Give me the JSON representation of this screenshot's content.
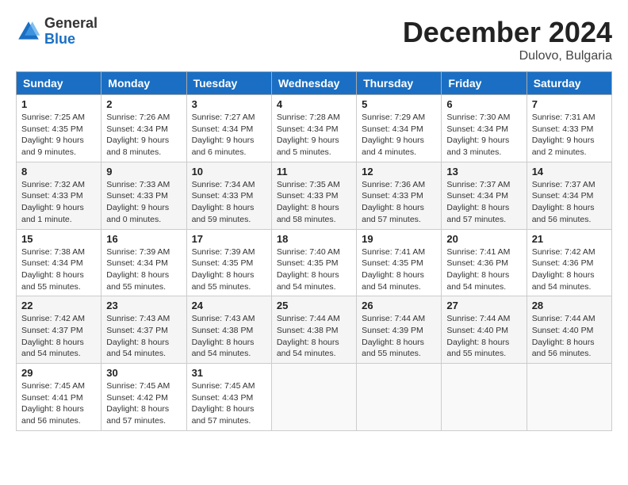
{
  "header": {
    "logo_general": "General",
    "logo_blue": "Blue",
    "month_title": "December 2024",
    "location": "Dulovo, Bulgaria"
  },
  "days_of_week": [
    "Sunday",
    "Monday",
    "Tuesday",
    "Wednesday",
    "Thursday",
    "Friday",
    "Saturday"
  ],
  "weeks": [
    [
      {
        "day": "1",
        "sunrise": "7:25 AM",
        "sunset": "4:35 PM",
        "daylight": "9 hours and 9 minutes."
      },
      {
        "day": "2",
        "sunrise": "7:26 AM",
        "sunset": "4:34 PM",
        "daylight": "9 hours and 8 minutes."
      },
      {
        "day": "3",
        "sunrise": "7:27 AM",
        "sunset": "4:34 PM",
        "daylight": "9 hours and 6 minutes."
      },
      {
        "day": "4",
        "sunrise": "7:28 AM",
        "sunset": "4:34 PM",
        "daylight": "9 hours and 5 minutes."
      },
      {
        "day": "5",
        "sunrise": "7:29 AM",
        "sunset": "4:34 PM",
        "daylight": "9 hours and 4 minutes."
      },
      {
        "day": "6",
        "sunrise": "7:30 AM",
        "sunset": "4:34 PM",
        "daylight": "9 hours and 3 minutes."
      },
      {
        "day": "7",
        "sunrise": "7:31 AM",
        "sunset": "4:33 PM",
        "daylight": "9 hours and 2 minutes."
      }
    ],
    [
      {
        "day": "8",
        "sunrise": "7:32 AM",
        "sunset": "4:33 PM",
        "daylight": "9 hours and 1 minute."
      },
      {
        "day": "9",
        "sunrise": "7:33 AM",
        "sunset": "4:33 PM",
        "daylight": "9 hours and 0 minutes."
      },
      {
        "day": "10",
        "sunrise": "7:34 AM",
        "sunset": "4:33 PM",
        "daylight": "8 hours and 59 minutes."
      },
      {
        "day": "11",
        "sunrise": "7:35 AM",
        "sunset": "4:33 PM",
        "daylight": "8 hours and 58 minutes."
      },
      {
        "day": "12",
        "sunrise": "7:36 AM",
        "sunset": "4:33 PM",
        "daylight": "8 hours and 57 minutes."
      },
      {
        "day": "13",
        "sunrise": "7:37 AM",
        "sunset": "4:34 PM",
        "daylight": "8 hours and 57 minutes."
      },
      {
        "day": "14",
        "sunrise": "7:37 AM",
        "sunset": "4:34 PM",
        "daylight": "8 hours and 56 minutes."
      }
    ],
    [
      {
        "day": "15",
        "sunrise": "7:38 AM",
        "sunset": "4:34 PM",
        "daylight": "8 hours and 55 minutes."
      },
      {
        "day": "16",
        "sunrise": "7:39 AM",
        "sunset": "4:34 PM",
        "daylight": "8 hours and 55 minutes."
      },
      {
        "day": "17",
        "sunrise": "7:39 AM",
        "sunset": "4:35 PM",
        "daylight": "8 hours and 55 minutes."
      },
      {
        "day": "18",
        "sunrise": "7:40 AM",
        "sunset": "4:35 PM",
        "daylight": "8 hours and 54 minutes."
      },
      {
        "day": "19",
        "sunrise": "7:41 AM",
        "sunset": "4:35 PM",
        "daylight": "8 hours and 54 minutes."
      },
      {
        "day": "20",
        "sunrise": "7:41 AM",
        "sunset": "4:36 PM",
        "daylight": "8 hours and 54 minutes."
      },
      {
        "day": "21",
        "sunrise": "7:42 AM",
        "sunset": "4:36 PM",
        "daylight": "8 hours and 54 minutes."
      }
    ],
    [
      {
        "day": "22",
        "sunrise": "7:42 AM",
        "sunset": "4:37 PM",
        "daylight": "8 hours and 54 minutes."
      },
      {
        "day": "23",
        "sunrise": "7:43 AM",
        "sunset": "4:37 PM",
        "daylight": "8 hours and 54 minutes."
      },
      {
        "day": "24",
        "sunrise": "7:43 AM",
        "sunset": "4:38 PM",
        "daylight": "8 hours and 54 minutes."
      },
      {
        "day": "25",
        "sunrise": "7:44 AM",
        "sunset": "4:38 PM",
        "daylight": "8 hours and 54 minutes."
      },
      {
        "day": "26",
        "sunrise": "7:44 AM",
        "sunset": "4:39 PM",
        "daylight": "8 hours and 55 minutes."
      },
      {
        "day": "27",
        "sunrise": "7:44 AM",
        "sunset": "4:40 PM",
        "daylight": "8 hours and 55 minutes."
      },
      {
        "day": "28",
        "sunrise": "7:44 AM",
        "sunset": "4:40 PM",
        "daylight": "8 hours and 56 minutes."
      }
    ],
    [
      {
        "day": "29",
        "sunrise": "7:45 AM",
        "sunset": "4:41 PM",
        "daylight": "8 hours and 56 minutes."
      },
      {
        "day": "30",
        "sunrise": "7:45 AM",
        "sunset": "4:42 PM",
        "daylight": "8 hours and 57 minutes."
      },
      {
        "day": "31",
        "sunrise": "7:45 AM",
        "sunset": "4:43 PM",
        "daylight": "8 hours and 57 minutes."
      },
      null,
      null,
      null,
      null
    ]
  ]
}
